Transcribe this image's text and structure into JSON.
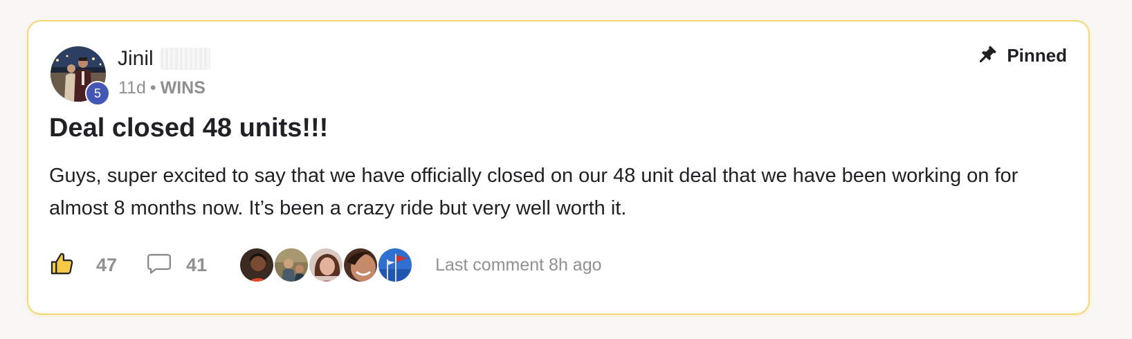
{
  "post": {
    "author": {
      "name": "Jinil",
      "level": "5"
    },
    "meta": {
      "age": "11d",
      "separator": "•",
      "category": "WINS"
    },
    "pinned_label": "Pinned",
    "title": "Deal closed 48 units!!!",
    "body": "Guys, super excited to say that we have officially closed on our 48 unit deal that we have been working on for almost 8 months now. It’s been a crazy ride but very well worth it.",
    "likes": "47",
    "comments": "41",
    "last_comment": "Last comment 8h ago"
  },
  "icons": {
    "pin": "pin-icon",
    "like": "thumbs-up-icon",
    "comment": "speech-bubble-icon"
  },
  "colors": {
    "card_border": "#f6d774",
    "level_badge": "#4557b5",
    "like_icon": "#f7c948",
    "muted_text": "#909090",
    "primary_text": "#202124"
  }
}
